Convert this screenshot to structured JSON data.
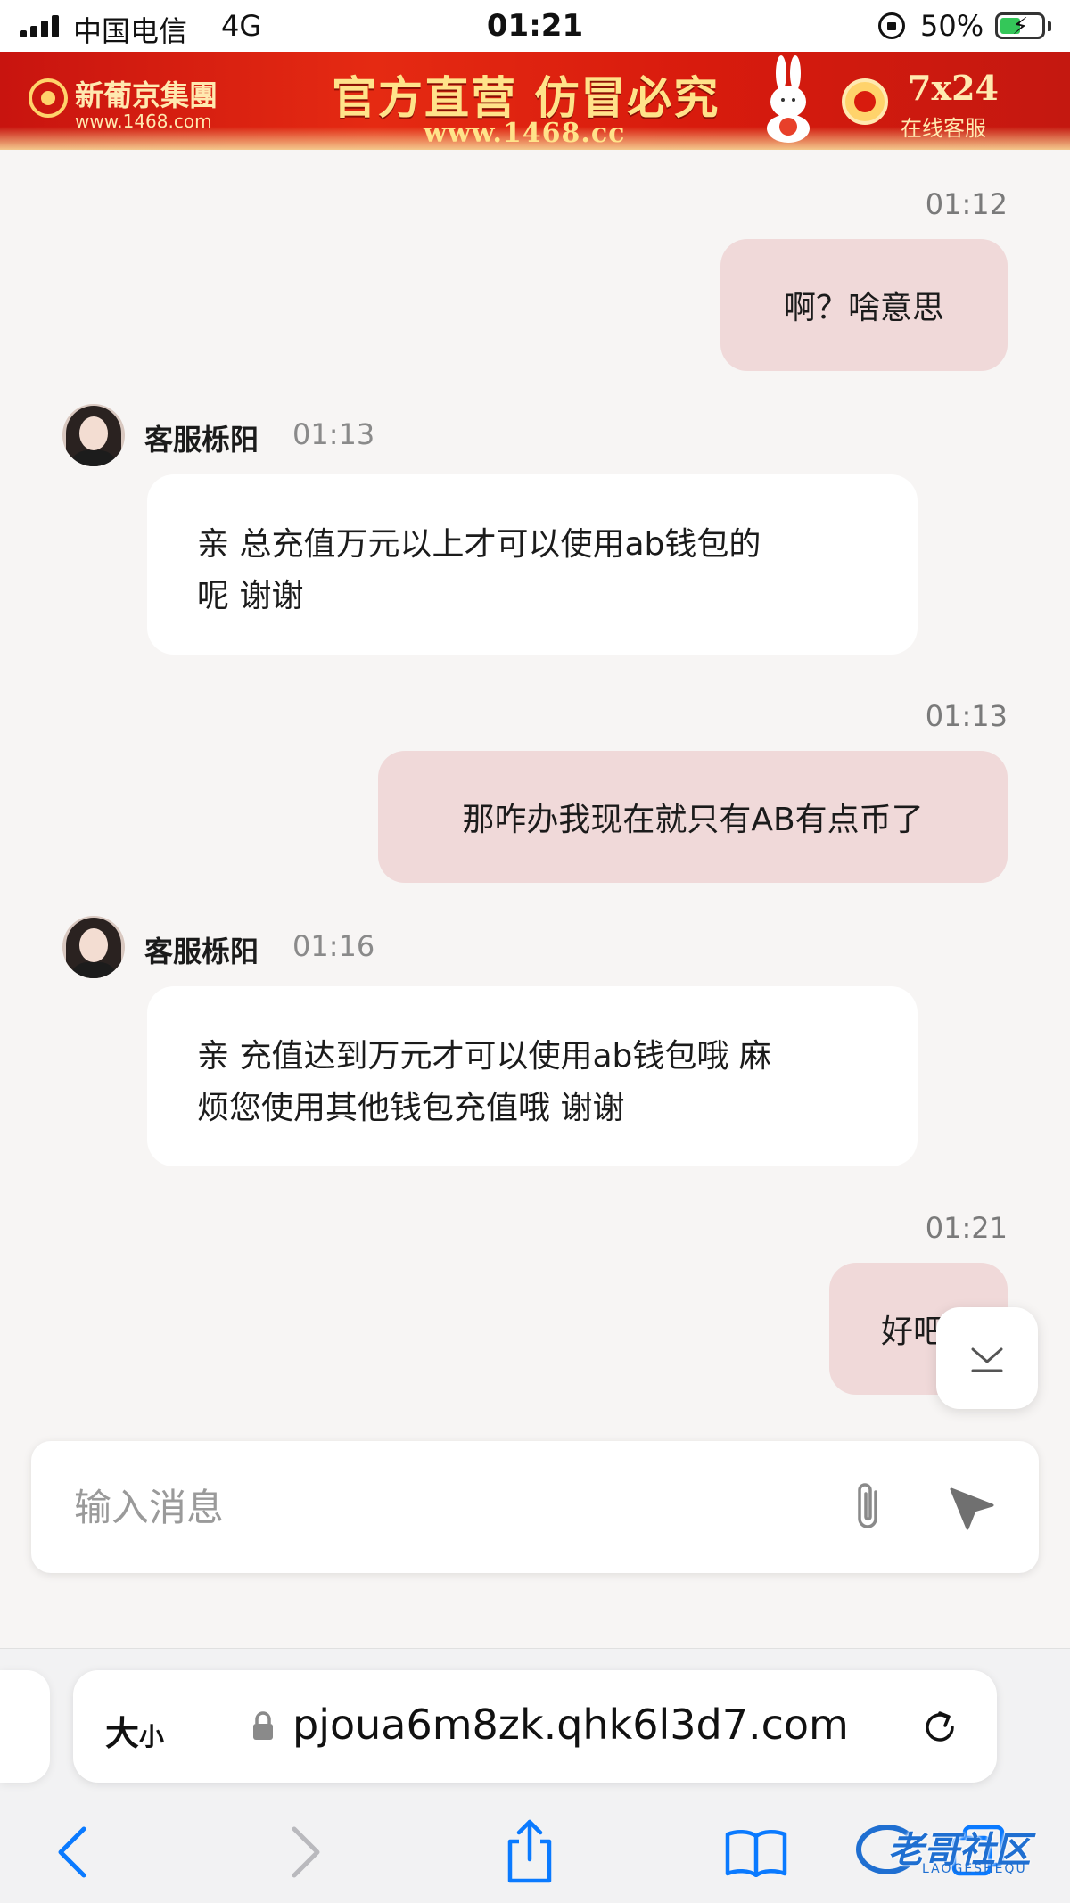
{
  "status_bar": {
    "carrier": "中国电信",
    "network": "4G",
    "time": "01:21",
    "battery_percent": "50%",
    "battery_level": 0.5,
    "charging_color": "#34c759"
  },
  "ad_banner": {
    "brand": "新葡京集團",
    "brand_url": "www.1468.com",
    "slogan": "官方直营  仿冒必究",
    "url": "www.1468.cc",
    "service_main": "7x24",
    "service_sub": "在线客服",
    "background_color": "#d81b0d",
    "text_color": "#ffe38a"
  },
  "chat": {
    "agent_name": "客服栎阳",
    "outgoing_bubble_color": "#f0d9d9",
    "incoming_bubble_color": "#ffffff",
    "messages": [
      {
        "direction": "out",
        "time": "01:12",
        "text": "啊？啥意思"
      },
      {
        "direction": "in",
        "time": "01:13",
        "text_line1": "亲 总充值万元以上才可以使用ab钱包的",
        "text_line2": "呢 谢谢"
      },
      {
        "direction": "out",
        "time": "01:13",
        "text": "那咋办我现在就只有AB有点币了"
      },
      {
        "direction": "in",
        "time": "01:16",
        "text_line1": "亲 充值达到万元才可以使用ab钱包哦 麻",
        "text_line2": "烦您使用其他钱包充值哦 谢谢"
      },
      {
        "direction": "out",
        "time": "01:21",
        "text": "好吧"
      }
    ]
  },
  "scroll_down_icon": "chevron-down-to-bottom-icon",
  "composer": {
    "placeholder": "输入消息",
    "value": "",
    "attach_icon": "paperclip-icon",
    "send_icon": "send-arrow-icon"
  },
  "safari": {
    "text_size_label": "大",
    "text_size_small": "小",
    "url": "pjoua6m8zk.qhk6l3d7.com",
    "icons": [
      "lock-icon",
      "reload-icon",
      "back-icon",
      "forward-icon",
      "share-icon",
      "bookmarks-icon",
      "tabs-icon"
    ],
    "accent_color": "#0a7aff"
  },
  "watermark": {
    "text": "老哥社区",
    "sub": "LAOGESHEQU"
  }
}
